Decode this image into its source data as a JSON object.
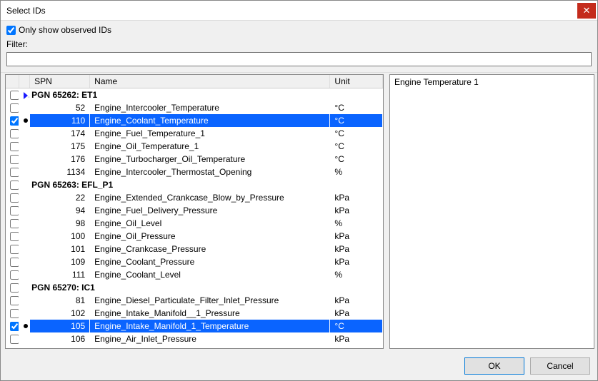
{
  "window": {
    "title": "Select IDs"
  },
  "toolbar": {
    "only_observed_label": "Only show observed IDs",
    "only_observed_checked": true,
    "filter_label": "Filter:",
    "filter_value": ""
  },
  "columns": {
    "chk": "",
    "spn": "SPN",
    "name": "Name",
    "unit": "Unit"
  },
  "groups": [
    {
      "label": "PGN 65262: ET1",
      "arrow": true,
      "rows": [
        {
          "checked": false,
          "sel": false,
          "spn": "52",
          "name": "Engine_Intercooler_Temperature",
          "unit": "°C"
        },
        {
          "checked": true,
          "sel": true,
          "spn": "110",
          "name": "Engine_Coolant_Temperature",
          "unit": "°C"
        },
        {
          "checked": false,
          "sel": false,
          "spn": "174",
          "name": "Engine_Fuel_Temperature_1",
          "unit": "°C"
        },
        {
          "checked": false,
          "sel": false,
          "spn": "175",
          "name": "Engine_Oil_Temperature_1",
          "unit": "°C"
        },
        {
          "checked": false,
          "sel": false,
          "spn": "176",
          "name": "Engine_Turbocharger_Oil_Temperature",
          "unit": "°C"
        },
        {
          "checked": false,
          "sel": false,
          "spn": "1134",
          "name": "Engine_Intercooler_Thermostat_Opening",
          "unit": "%"
        }
      ]
    },
    {
      "label": "PGN 65263: EFL_P1",
      "arrow": false,
      "rows": [
        {
          "checked": false,
          "sel": false,
          "spn": "22",
          "name": "Engine_Extended_Crankcase_Blow_by_Pressure",
          "unit": "kPa"
        },
        {
          "checked": false,
          "sel": false,
          "spn": "94",
          "name": "Engine_Fuel_Delivery_Pressure",
          "unit": "kPa"
        },
        {
          "checked": false,
          "sel": false,
          "spn": "98",
          "name": "Engine_Oil_Level",
          "unit": "%"
        },
        {
          "checked": false,
          "sel": false,
          "spn": "100",
          "name": "Engine_Oil_Pressure",
          "unit": "kPa"
        },
        {
          "checked": false,
          "sel": false,
          "spn": "101",
          "name": "Engine_Crankcase_Pressure",
          "unit": "kPa"
        },
        {
          "checked": false,
          "sel": false,
          "spn": "109",
          "name": "Engine_Coolant_Pressure",
          "unit": "kPa"
        },
        {
          "checked": false,
          "sel": false,
          "spn": "111",
          "name": "Engine_Coolant_Level",
          "unit": "%"
        }
      ]
    },
    {
      "label": "PGN 65270: IC1",
      "arrow": false,
      "rows": [
        {
          "checked": false,
          "sel": false,
          "spn": "81",
          "name": "Engine_Diesel_Particulate_Filter_Inlet_Pressure",
          "unit": "kPa"
        },
        {
          "checked": false,
          "sel": false,
          "spn": "102",
          "name": "Engine_Intake_Manifold__1_Pressure",
          "unit": "kPa"
        },
        {
          "checked": true,
          "sel": true,
          "spn": "105",
          "name": "Engine_Intake_Manifold_1_Temperature",
          "unit": "°C"
        },
        {
          "checked": false,
          "sel": false,
          "spn": "106",
          "name": "Engine_Air_Inlet_Pressure",
          "unit": "kPa"
        }
      ]
    }
  ],
  "right_panel": {
    "text": "Engine Temperature 1"
  },
  "buttons": {
    "ok": "OK",
    "cancel": "Cancel"
  }
}
